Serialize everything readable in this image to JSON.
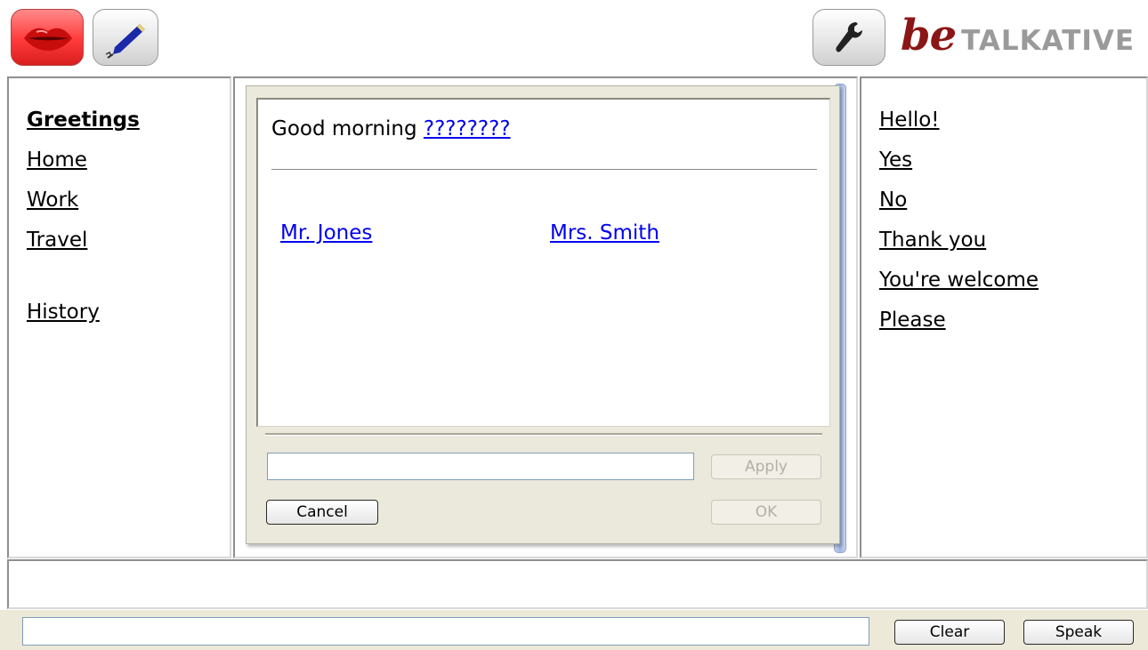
{
  "toolbar": {
    "speak_icon": "lips-icon",
    "edit_icon": "pen-icon",
    "settings_icon": "wrench-icon"
  },
  "brand": {
    "prefix": "be",
    "name": "TALKATIVE",
    "colors": {
      "prefix": "#8b1616",
      "name": "#9a9a9a"
    }
  },
  "categories": {
    "items": [
      "Greetings",
      "Home",
      "Work",
      "Travel"
    ],
    "selected": "Greetings",
    "history": "History"
  },
  "dialog": {
    "sentence": "Good morning",
    "blank": "????????",
    "options": [
      "Mr. Jones",
      "Mrs. Smith"
    ],
    "input_value": "",
    "apply_label": "Apply",
    "cancel_label": "Cancel",
    "ok_label": "OK"
  },
  "phrases": [
    "Hello!",
    "Yes",
    "No",
    "Thank you",
    "You're welcome",
    "Please"
  ],
  "bottom": {
    "input_value": "",
    "clear_label": "Clear",
    "speak_label": "Speak"
  },
  "colors": {
    "link": "#0000ee",
    "dialog_bg": "#ebe9dc",
    "bar_bg": "#ece9d8",
    "accent_red": "#ff3a3a"
  }
}
